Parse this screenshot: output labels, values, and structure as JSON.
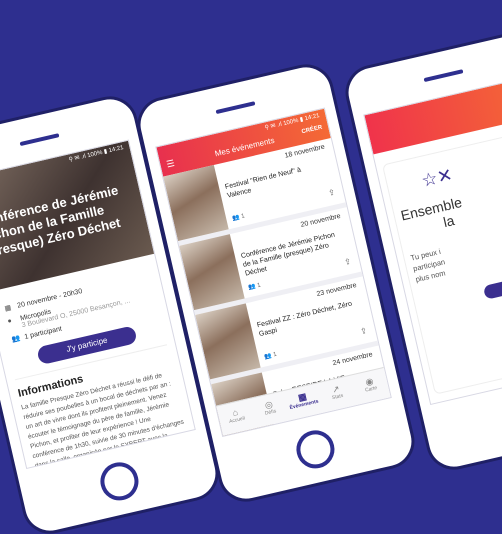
{
  "phone1": {
    "status": "⚲ ✉ .ıl 100% ▮ 14:21",
    "title": "Conférence de Jérémie Pichon de la Famille (presque) Zéro Déchet",
    "date": "20 novembre - 20h30",
    "venue": "Micropolis",
    "address": "3 Boulevard O, 25000 Besançon, ...",
    "participants": "1 participant",
    "button": "J'y participe",
    "info_heading": "Informations",
    "info_text": "La famille Presque Zéro Déchet a réussi le défi de réduire ses poubelles à un bocal de déchets par an : un art de vivre dont ils profitent pleinement. Venez écouter le témoignage du père de famille, Jérémie Pichon, et profiter de leur expérience ! Une conférence de 1h30, suivie de 30 minutes d'échanges dans la salle, organisée par le SYBERT avec la présence du groupe local Zéro Déchet"
  },
  "phone2": {
    "status": "⚲ ✉ .ıl 100% ▮ 14:21",
    "header_title": "Mes événements",
    "create_label": "CRÉER",
    "events": [
      {
        "date": "18 novembre",
        "name": "Festival \"Rien de Neuf\" à Valence",
        "count": "1"
      },
      {
        "date": "20 novembre",
        "name": "Conférence de Jérémie Pichon de la Famille (presque) Zéro Déchet",
        "count": "1"
      },
      {
        "date": "23 novembre",
        "name": "Festival ZZ : Zéro Déchet, Zéro Gaspi",
        "count": "1"
      },
      {
        "date": "24 novembre",
        "name": "Salon RESPIRE LA VIE",
        "count": ""
      }
    ],
    "tabs": [
      {
        "label": "Accueil",
        "icon": "⌂"
      },
      {
        "label": "Défis",
        "icon": "◎"
      },
      {
        "label": "Événements",
        "icon": "▦"
      },
      {
        "label": "Stats",
        "icon": "↗"
      },
      {
        "label": "Carte",
        "icon": "◉"
      }
    ]
  },
  "phone3": {
    "title": "Ensemble",
    "title2": "la",
    "text1": "Tu peux i",
    "text2": "participan",
    "text3": "plus nom"
  },
  "colors": {
    "background": "#2e2f8f",
    "accent": "#3b2f8f",
    "header_start": "#e8304e",
    "header_end": "#f46a35"
  }
}
